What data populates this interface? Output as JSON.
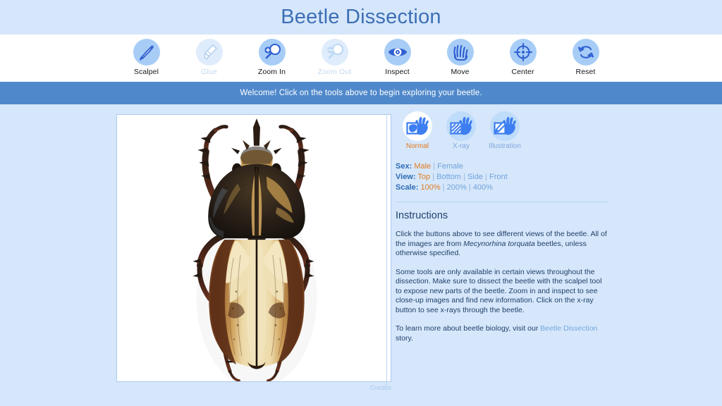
{
  "header": {
    "title": "Beetle Dissection"
  },
  "toolbar": {
    "tools": [
      {
        "label": "Scalpel",
        "icon": "scalpel-icon",
        "disabled": false
      },
      {
        "label": "Glue",
        "icon": "glue-icon",
        "disabled": true
      },
      {
        "label": "Zoom In",
        "icon": "zoom-in-icon",
        "disabled": false
      },
      {
        "label": "Zoom Out",
        "icon": "zoom-out-icon",
        "disabled": true
      },
      {
        "label": "Inspect",
        "icon": "eye-icon",
        "disabled": false
      },
      {
        "label": "Move",
        "icon": "hand-move-icon",
        "disabled": false
      },
      {
        "label": "Center",
        "icon": "crosshair-icon",
        "disabled": false
      },
      {
        "label": "Reset",
        "icon": "refresh-icon",
        "disabled": false
      }
    ]
  },
  "banner": {
    "message": "Welcome! Click on the tools above to begin exploring your beetle."
  },
  "image_panel": {
    "subject": "Mecynorhina torquata beetle, dorsal view",
    "credits_label": "Credits"
  },
  "view_modes": [
    {
      "label": "Normal",
      "icon": "glove-frame-icon",
      "active": true
    },
    {
      "label": "X-ray",
      "icon": "glove-xray-icon",
      "active": false
    },
    {
      "label": "Illustration",
      "icon": "glove-pencil-icon",
      "active": false
    }
  ],
  "options": [
    {
      "key": "Sex:",
      "values": [
        {
          "text": "Male",
          "selected": true
        },
        {
          "text": "Female",
          "selected": false
        }
      ]
    },
    {
      "key": "View:",
      "values": [
        {
          "text": "Top",
          "selected": true
        },
        {
          "text": "Bottom",
          "selected": false
        },
        {
          "text": "Side",
          "selected": false
        },
        {
          "text": "Front",
          "selected": false
        }
      ]
    },
    {
      "key": "Scale:",
      "values": [
        {
          "text": "100%",
          "selected": true
        },
        {
          "text": "200%",
          "selected": false
        },
        {
          "text": "400%",
          "selected": false
        }
      ]
    }
  ],
  "instructions": {
    "heading": "Instructions",
    "para1_a": "Click the buttons above to see different views of the beetle. All of the images are from ",
    "para1_sci": "Mecynorhina torquata",
    "para1_b": " beetles, unless otherwise specified.",
    "para2": "Some tools are only available in certain views throughout the dissection. Make sure to dissect the beetle with the scalpel tool to expose new parts of the beetle. Zoom in and inspect to see close-up images and find new information. Click on the x-ray button to see x-rays through the beetle.",
    "para3_a": "To learn more about beetle biology, visit our ",
    "para3_link": "Beetle Dissection",
    "para3_b": " story."
  },
  "colors": {
    "page_background": "#d6e7fb",
    "banner_blue": "#5089cb",
    "title_blue": "#3d6fb5",
    "accent_orange": "#e07b1f",
    "icon_blue": "#2f6cd8",
    "icon_circle": "#a7cdf7"
  }
}
